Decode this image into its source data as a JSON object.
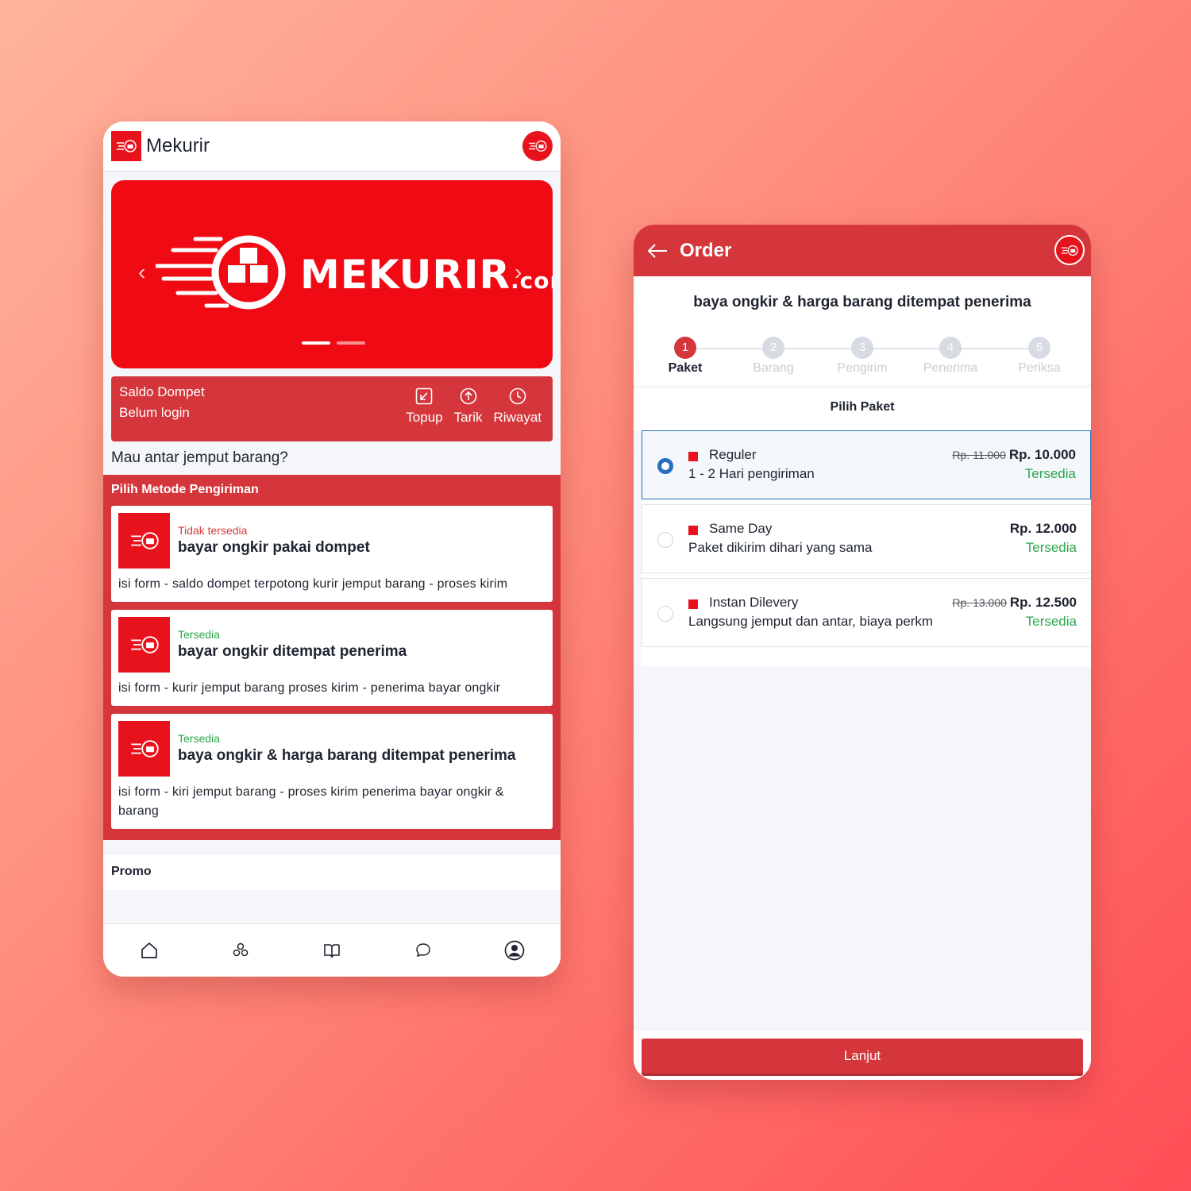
{
  "left": {
    "header": {
      "title": "Mekurir"
    },
    "banner": {
      "brand": "MEKURIR",
      "brand_suffix": ".com",
      "prev": "‹",
      "next": "›"
    },
    "wallet": {
      "title": "Saldo Dompet",
      "status": "Belum login",
      "actions": [
        {
          "label": "Topup",
          "icon": "topup-icon"
        },
        {
          "label": "Tarik",
          "icon": "withdraw-icon"
        },
        {
          "label": "Riwayat",
          "icon": "history-icon"
        }
      ]
    },
    "question": "Mau antar jemput barang?",
    "methods": {
      "title": "Pilih Metode Pengiriman",
      "items": [
        {
          "status": "Tidak tersedia",
          "name": "bayar ongkir pakai dompet",
          "desc": "isi form - saldo dompet terpotong kurir jemput barang - proses kirim"
        },
        {
          "status": "Tersedia",
          "name": "bayar ongkir ditempat penerima",
          "desc": "isi form - kurir jemput barang proses kirim - penerima bayar ongkir"
        },
        {
          "status": "Tersedia",
          "name": "baya ongkir & harga barang ditempat penerima",
          "desc": "isi form - kiri jemput barang - proses kirim penerima bayar ongkir & barang"
        }
      ]
    },
    "promo": "Promo",
    "nav": [
      "home-icon",
      "modules-icon",
      "book-icon",
      "chat-icon",
      "profile-icon"
    ]
  },
  "right": {
    "header": {
      "title": "Order",
      "back": "←"
    },
    "heading": "baya ongkir & harga barang ditempat penerima",
    "steps": [
      {
        "num": "1",
        "label": "Paket",
        "active": true
      },
      {
        "num": "2",
        "label": "Barang",
        "active": false
      },
      {
        "num": "3",
        "label": "Pengirim",
        "active": false
      },
      {
        "num": "4",
        "label": "Penerima",
        "active": false
      },
      {
        "num": "5",
        "label": "Periksa",
        "active": false
      }
    ],
    "section_title": "Pilih Paket",
    "packages": [
      {
        "name": "Reguler",
        "desc": "1 - 2 Hari pengiriman",
        "old_price": "Rp. 11.000",
        "price": "Rp. 10.000",
        "availability": "Tersedia",
        "selected": true
      },
      {
        "name": "Same Day",
        "desc": "Paket dikirim dihari yang sama",
        "old_price": "",
        "price": "Rp. 12.000",
        "availability": "Tersedia",
        "selected": false
      },
      {
        "name": "Instan Dilevery",
        "desc": "Langsung jemput dan antar, biaya perkm",
        "old_price": "Rp. 13.000",
        "price": "Rp. 12.500",
        "availability": "Tersedia",
        "selected": false
      }
    ],
    "next_button": "Lanjut"
  },
  "colors": {
    "brand_red": "#e8121c",
    "header_red": "#d5363b",
    "available_green": "#2aa64a",
    "unavailable_red": "#d23a3a",
    "selected_blue": "#2a6ec2"
  }
}
